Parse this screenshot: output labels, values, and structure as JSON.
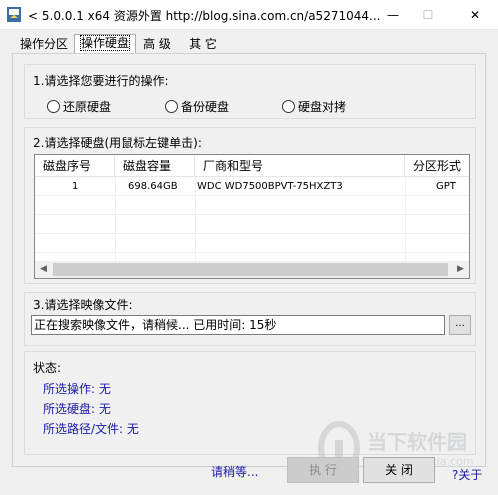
{
  "window": {
    "title": "< 5.0.0.1 x64 资源外置 http://blog.sina.com.cn/a5271044...",
    "min_glyph": "—",
    "max_glyph": "☐",
    "close_glyph": "✕",
    "icon": "app-icon"
  },
  "tabs": [
    {
      "label": "操作分区",
      "active": false
    },
    {
      "label": "操作硬盘",
      "active": true
    },
    {
      "label": "高 级",
      "active": false
    },
    {
      "label": "其 它",
      "active": false
    }
  ],
  "operation": {
    "label": "1.请选择您要进行的操作:",
    "options": [
      {
        "label": "还原硬盘",
        "selected": false
      },
      {
        "label": "备份硬盘",
        "selected": false
      },
      {
        "label": "硬盘对拷",
        "selected": false
      }
    ]
  },
  "disk": {
    "label": "2.请选择硬盘(用鼠标左键单击):",
    "columns": [
      "磁盘序号",
      "磁盘容量",
      "厂商和型号",
      "分区形式"
    ],
    "rows": [
      {
        "index": "1",
        "capacity": "698.64GB",
        "model": "WDC WD7500BPVT-75HXZT3",
        "scheme": "GPT"
      }
    ],
    "scroll_left": "◀",
    "scroll_right": "▶"
  },
  "image": {
    "label": "3.请选择映像文件:",
    "value": "正在搜索映像文件，请稍候...   已用时间: 15秒",
    "browse_label": "..."
  },
  "status": {
    "label": "状态:",
    "lines": [
      "所选操作: 无",
      "所选硬盘: 无",
      "所选路径/文件: 无"
    ]
  },
  "footer": {
    "please_wait": "请稍等...",
    "run_label": "执 行",
    "close_label": "关 闭",
    "about_label": "?关于"
  },
  "watermark": {
    "text": "当下软件园",
    "url": "www.downxia.com"
  }
}
